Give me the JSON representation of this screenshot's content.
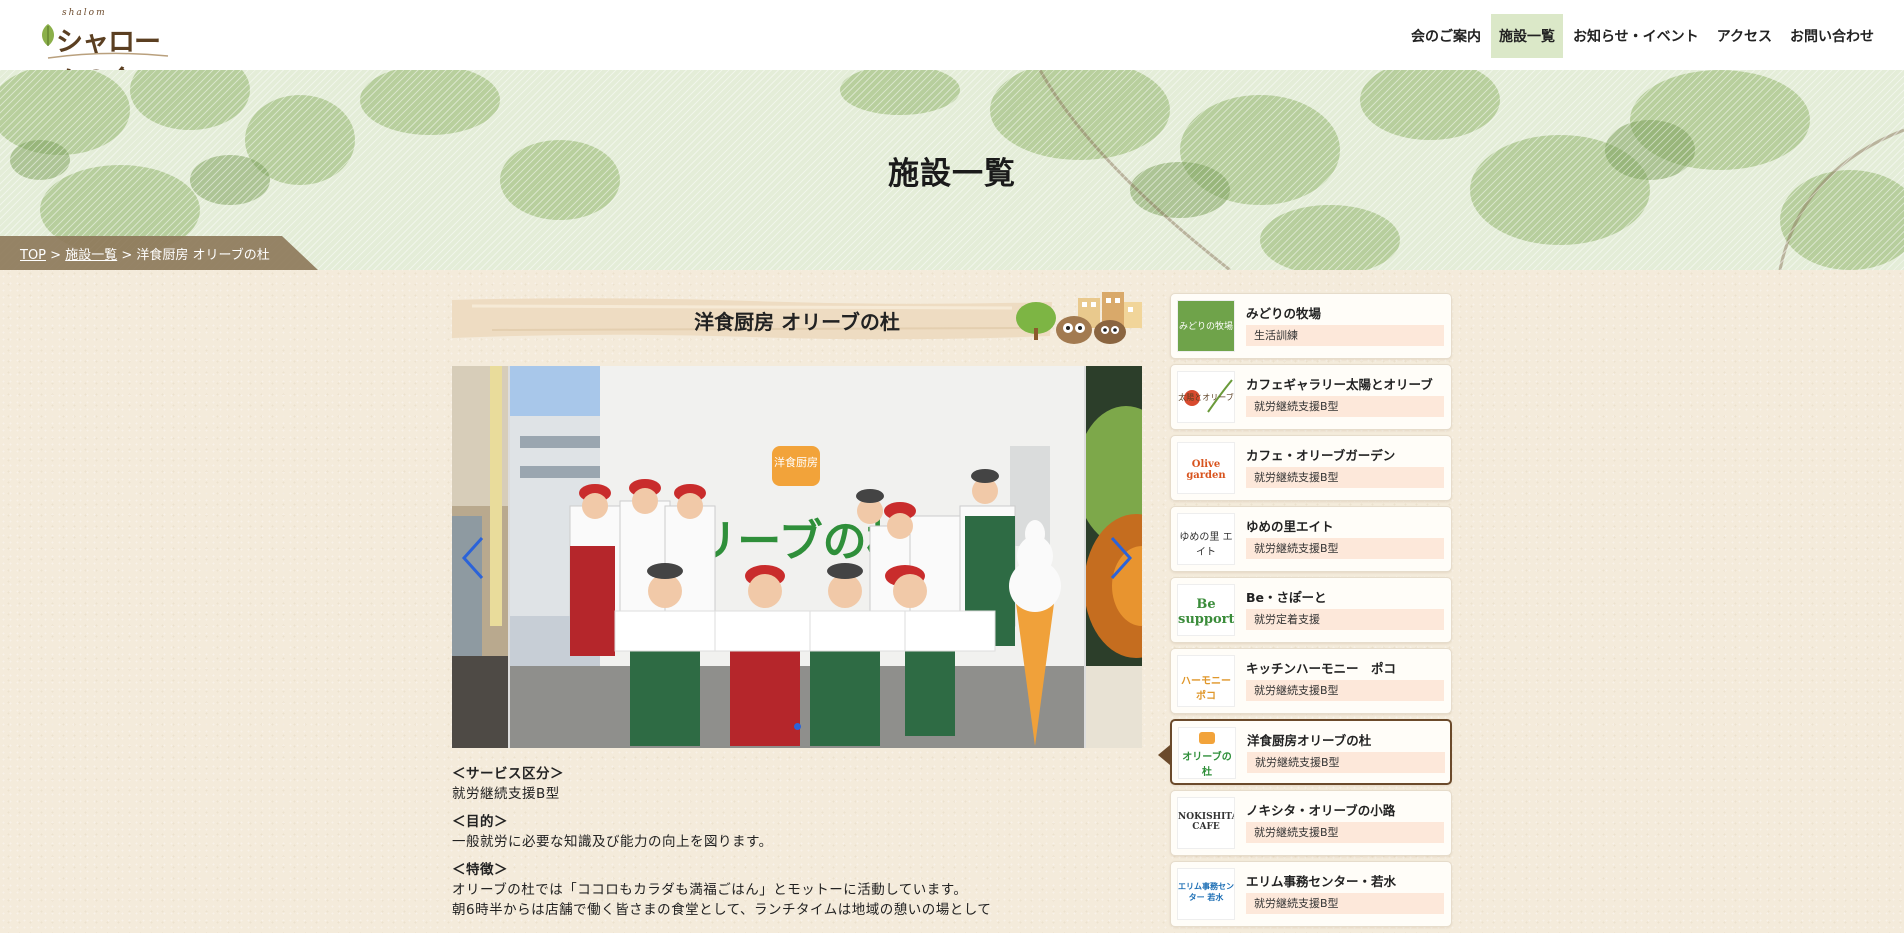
{
  "header": {
    "logo_roman": "shalom",
    "logo_text": "シャロームの会",
    "nav": [
      {
        "label": "会のご案内",
        "active": false
      },
      {
        "label": "施設一覧",
        "active": true
      },
      {
        "label": "お知らせ・イベント",
        "active": false
      },
      {
        "label": "アクセス",
        "active": false
      },
      {
        "label": "お問い合わせ",
        "active": false
      }
    ]
  },
  "hero": {
    "title": "施設一覧"
  },
  "breadcrumb": {
    "top": "TOP",
    "sep1": " > ",
    "list": "施設一覧",
    "sep2": " > ",
    "current": "洋食厨房 オリーブの杜"
  },
  "main": {
    "title": "洋食厨房 オリーブの杜",
    "photo_sign_top": "洋食厨房",
    "photo_sign_main": "オリーブの杜",
    "service_head": "＜サービス区分＞",
    "service_value": "就労継続支援B型",
    "purpose_head": "＜目的＞",
    "purpose_value": "一般就労に必要な知識及び能力の向上を図ります。",
    "feature_head": "＜特徴＞",
    "feature_value": "オリーブの杜では「ココロもカラダも満福ごはん」とモットーに活動しています。",
    "feature_value2": "朝6時半からは店舗で働く皆さまの食堂として、ランチタイムは地域の憩いの場として"
  },
  "slider": {
    "total_dots": 1,
    "active_dot": 0
  },
  "sidebar": [
    {
      "name": "みどりの牧場",
      "tag": "生活訓練",
      "current": false,
      "thumb": "みどりの牧場"
    },
    {
      "name": "カフェギャラリー太陽とオリーブ",
      "tag": "就労継続支援B型",
      "current": false,
      "thumb": "太陽とオリーブ"
    },
    {
      "name": "カフェ・オリーブガーデン",
      "tag": "就労継続支援B型",
      "current": false,
      "thumb": "Olive garden"
    },
    {
      "name": "ゆめの里エイト",
      "tag": "就労継続支援B型",
      "current": false,
      "thumb": "ゆめの里 エイト"
    },
    {
      "name": "Be・さぽーと",
      "tag": "就労定着支援",
      "current": false,
      "thumb": "Be support"
    },
    {
      "name": "キッチンハーモニー　ポコ",
      "tag": "就労継続支援B型",
      "current": false,
      "thumb": "ハーモニー ポコ"
    },
    {
      "name": "洋食厨房オリーブの杜",
      "tag": "就労継続支援B型",
      "current": true,
      "thumb": "オリーブの杜"
    },
    {
      "name": "ノキシタ・オリーブの小路",
      "tag": "就労継続支援B型",
      "current": false,
      "thumb": "NOKISHITA CAFE"
    },
    {
      "name": "エリム事務センター・若水",
      "tag": "就労継続支援B型",
      "current": false,
      "thumb": "エリム事務センター 若水"
    }
  ],
  "colors": {
    "accent_green": "#dbe8c8",
    "tag_bg": "#fde8da",
    "brown": "#6b4a2b",
    "slider_dot": "#2b63d9"
  }
}
